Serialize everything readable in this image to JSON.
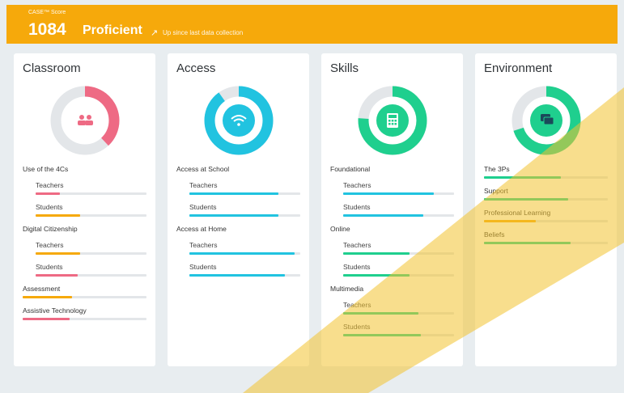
{
  "banner": {
    "label": "CASE™ Score",
    "score": "1084",
    "level": "Proficient",
    "trend_icon": "arrow-up-right-icon",
    "trend_text": "Up since last data collection",
    "color": "#f6a90b"
  },
  "colors": {
    "pink": "#ee6a84",
    "blue": "#21c3e0",
    "green": "#1fcf8e",
    "orange": "#f6a90b",
    "track": "#e3e6e9"
  },
  "cards": [
    {
      "title": "Classroom",
      "icon": "people-icon",
      "donut": {
        "percent": 0.38,
        "color": "#ee6a84"
      },
      "items": [
        {
          "type": "group",
          "label": "Use of the 4Cs"
        },
        {
          "type": "sub",
          "label": "Teachers",
          "value": 0.22,
          "color": "#ee6a84"
        },
        {
          "type": "sub",
          "label": "Students",
          "value": 0.4,
          "color": "#f6a90b"
        },
        {
          "type": "group",
          "label": "Digital Citizenship"
        },
        {
          "type": "sub",
          "label": "Teachers",
          "value": 0.4,
          "color": "#f6a90b"
        },
        {
          "type": "sub",
          "label": "Students",
          "value": 0.38,
          "color": "#ee6a84"
        },
        {
          "type": "bar",
          "label": "Assessment",
          "value": 0.4,
          "color": "#f6a90b"
        },
        {
          "type": "bar",
          "label": "Assistive Technology",
          "value": 0.38,
          "color": "#ee6a84"
        }
      ]
    },
    {
      "title": "Access",
      "icon": "wifi-icon",
      "donut": {
        "percent": 0.9,
        "color": "#21c3e0"
      },
      "items": [
        {
          "type": "group",
          "label": "Access at School"
        },
        {
          "type": "sub",
          "label": "Teachers",
          "value": 0.8,
          "color": "#21c3e0"
        },
        {
          "type": "sub",
          "label": "Students",
          "value": 0.8,
          "color": "#21c3e0"
        },
        {
          "type": "group",
          "label": "Access at Home"
        },
        {
          "type": "sub",
          "label": "Teachers",
          "value": 0.95,
          "color": "#21c3e0"
        },
        {
          "type": "sub",
          "label": "Students",
          "value": 0.86,
          "color": "#21c3e0"
        }
      ]
    },
    {
      "title": "Skills",
      "icon": "calculator-icon",
      "donut": {
        "percent": 0.76,
        "color": "#1fcf8e"
      },
      "items": [
        {
          "type": "group",
          "label": "Foundational"
        },
        {
          "type": "sub",
          "label": "Teachers",
          "value": 0.82,
          "color": "#21c3e0"
        },
        {
          "type": "sub",
          "label": "Students",
          "value": 0.72,
          "color": "#21c3e0"
        },
        {
          "type": "group",
          "label": "Online"
        },
        {
          "type": "sub",
          "label": "Teachers",
          "value": 0.6,
          "color": "#1fcf8e"
        },
        {
          "type": "sub",
          "label": "Students",
          "value": 0.6,
          "color": "#1fcf8e"
        },
        {
          "type": "group",
          "label": "Multimedia"
        },
        {
          "type": "sub",
          "label": "Teachers",
          "value": 0.68,
          "color": "#1fcf8e"
        },
        {
          "type": "sub",
          "label": "Students",
          "value": 0.7,
          "color": "#1fcf8e"
        }
      ]
    },
    {
      "title": "Environment",
      "icon": "chat-bubbles-icon",
      "donut": {
        "percent": 0.7,
        "color": "#1fcf8e"
      },
      "items": [
        {
          "type": "bar",
          "label": "The 3Ps",
          "value": 0.62,
          "color": "#1fcf8e"
        },
        {
          "type": "bar",
          "label": "Support",
          "value": 0.68,
          "color": "#1fcf8e"
        },
        {
          "type": "bar",
          "label": "Professional Learning",
          "value": 0.42,
          "color": "#f6a90b"
        },
        {
          "type": "bar",
          "label": "Beliefs",
          "value": 0.7,
          "color": "#1fcf8e"
        }
      ]
    }
  ]
}
